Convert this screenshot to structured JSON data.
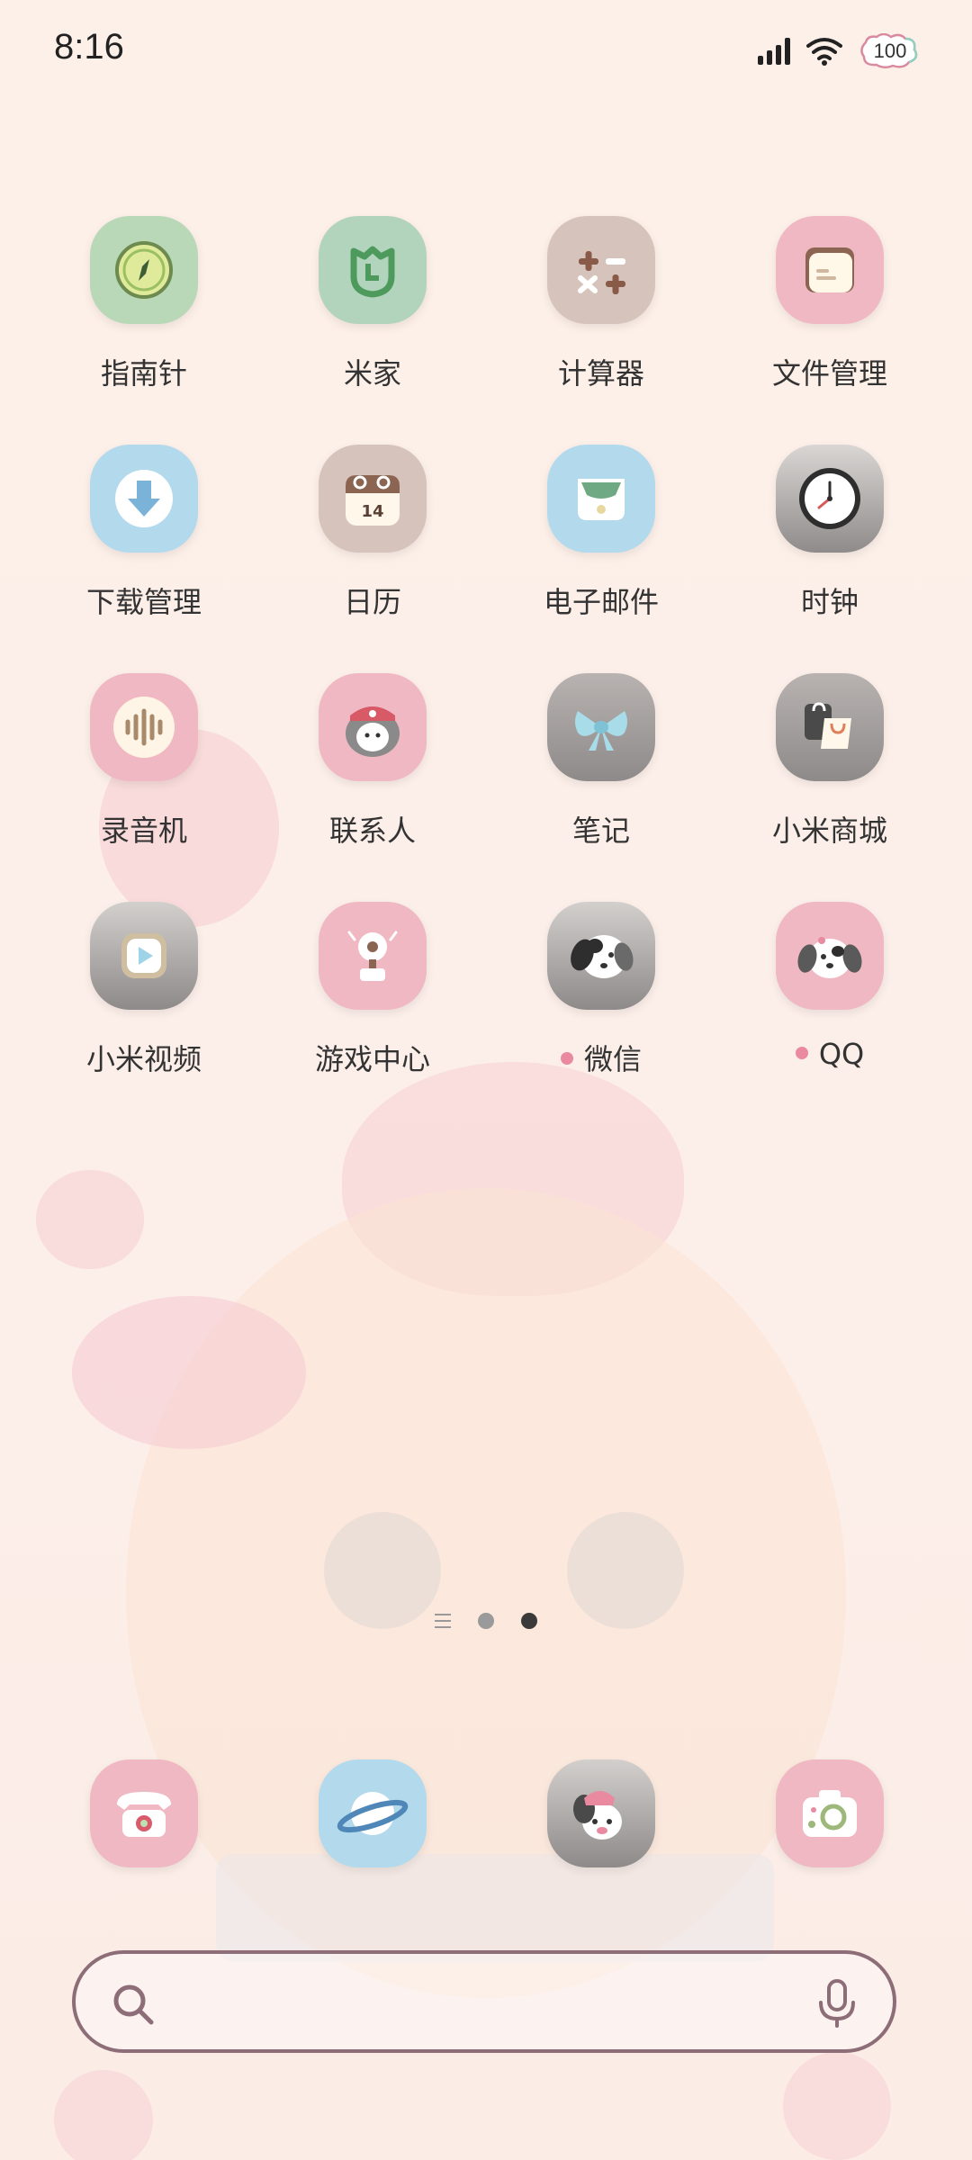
{
  "status_bar": {
    "time": "8:16",
    "battery": "100"
  },
  "grid_apps": [
    {
      "label": "指南针",
      "icon": "compass-icon",
      "color": "#b9d8b8"
    },
    {
      "label": "米家",
      "icon": "mijia-icon",
      "color": "#b3d4bc"
    },
    {
      "label": "计算器",
      "icon": "calculator-icon",
      "color": "#d6c4bc"
    },
    {
      "label": "文件管理",
      "icon": "folder-icon",
      "color": "#f0b8c2"
    },
    {
      "label": "下载管理",
      "icon": "download-icon",
      "color": "#b3daec"
    },
    {
      "label": "日历",
      "icon": "calendar-icon",
      "color": "#d6c4bc"
    },
    {
      "label": "电子邮件",
      "icon": "email-icon",
      "color": "#b3daec"
    },
    {
      "label": "时钟",
      "icon": "clock-icon",
      "color": "#bdb6b4"
    },
    {
      "label": "录音机",
      "icon": "recorder-icon",
      "color": "#f0b8c2"
    },
    {
      "label": "联系人",
      "icon": "contacts-icon",
      "color": "#f0b8c2"
    },
    {
      "label": "笔记",
      "icon": "notes-icon",
      "color": "#bdb6b4"
    },
    {
      "label": "小米商城",
      "icon": "shop-icon",
      "color": "#bdb6b4"
    },
    {
      "label": "小米视频",
      "icon": "video-icon",
      "color": "#bdb6b4"
    },
    {
      "label": "游戏中心",
      "icon": "game-center-icon",
      "color": "#f0b8c2"
    },
    {
      "label": "微信",
      "icon": "wechat-icon",
      "color": "#bdb6b4",
      "notify": true
    },
    {
      "label": "QQ",
      "icon": "qq-icon",
      "color": "#f0b8c2",
      "notify": true
    }
  ],
  "dock_apps": [
    {
      "icon": "phone-icon",
      "color": "#f0b8c2"
    },
    {
      "icon": "browser-icon",
      "color": "#b3daec"
    },
    {
      "icon": "messages-icon",
      "color": "#bdb6b4"
    },
    {
      "icon": "camera-icon",
      "color": "#f0b8c2"
    }
  ],
  "page_indicator": {
    "pages": 2,
    "active": 1
  },
  "colors": {
    "notify_dot": "#e98aa0",
    "search_border": "#8d6e78"
  }
}
